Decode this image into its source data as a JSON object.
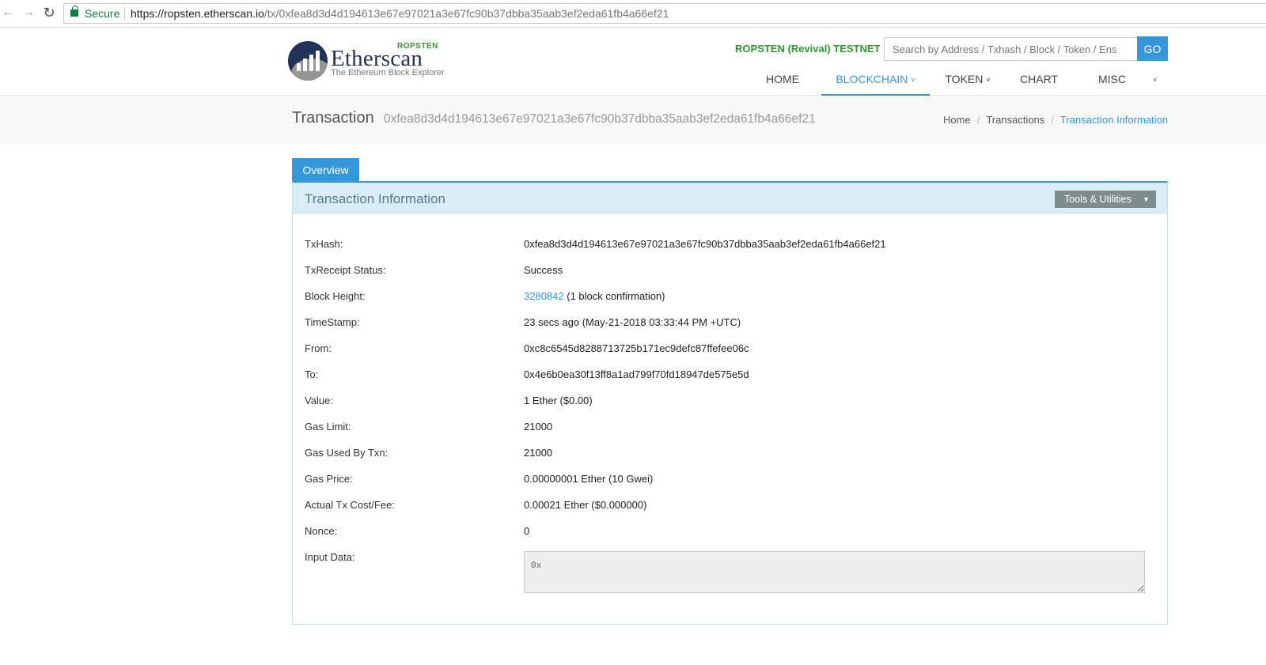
{
  "browser": {
    "secure_label": "Secure",
    "url_host": "https://ropsten.etherscan.io",
    "url_path": "/tx/0xfea8d3d4d194613e67e97021a3e67fc90b37dbba35aab3ef2eda61fb4a66ef21"
  },
  "header": {
    "logo_word": "Etherscan",
    "logo_tag": "ROPSTEN",
    "logo_sub": "The Ethereum Block Explorer",
    "network_label": "ROPSTEN (Revival) TESTNET",
    "search_placeholder": "Search by Address / Txhash / Block / Token / Ens",
    "go_label": "GO",
    "nav": {
      "home": "HOME",
      "blockchain": "BLOCKCHAIN",
      "token": "TOKEN",
      "chart": "CHART",
      "misc": "MISC"
    }
  },
  "title_band": {
    "title": "Transaction",
    "hash": "0xfea8d3d4d194613e67e97021a3e67fc90b37dbba35aab3ef2eda61fb4a66ef21",
    "breadcrumb": {
      "home": "Home",
      "transactions": "Transactions",
      "current": "Transaction Information"
    }
  },
  "tab_overview": "Overview",
  "panel": {
    "title": "Transaction Information",
    "tools_label": "Tools & Utilities"
  },
  "tx": {
    "txhash": {
      "label": "TxHash:",
      "value": "0xfea8d3d4d194613e67e97021a3e67fc90b37dbba35aab3ef2eda61fb4a66ef21"
    },
    "status": {
      "label": "TxReceipt Status:",
      "value": "Success"
    },
    "block": {
      "label": "Block Height:",
      "link": "3280842",
      "suffix": " (1 block confirmation)"
    },
    "timestamp": {
      "label": "TimeStamp:",
      "value": "23 secs ago (May-21-2018 03:33:44 PM +UTC)"
    },
    "from": {
      "label": "From:",
      "value": "0xc8c6545d8288713725b171ec9defc87ffefee06c"
    },
    "to": {
      "label": "To:",
      "value": "0x4e6b0ea30f13ff8a1ad799f70fd18947de575e5d"
    },
    "value": {
      "label": "Value:",
      "value": "1 Ether ($0.00)"
    },
    "gas_limit": {
      "label": "Gas Limit:",
      "value": "21000"
    },
    "gas_used": {
      "label": "Gas Used By Txn:",
      "value": "21000"
    },
    "gas_price": {
      "label": "Gas Price:",
      "value": "0.00000001 Ether (10 Gwei)"
    },
    "fee": {
      "label": "Actual Tx Cost/Fee:",
      "value": "0.00021 Ether ($0.000000)"
    },
    "nonce": {
      "label": "Nonce:",
      "value": "0"
    },
    "input": {
      "label": "Input Data:",
      "value": "0x"
    }
  },
  "colors": {
    "accent": "#3498db",
    "testnet_green": "#2e9a2e",
    "panel_head_bg": "#d9edf7",
    "logo_navy": "#21325b"
  }
}
